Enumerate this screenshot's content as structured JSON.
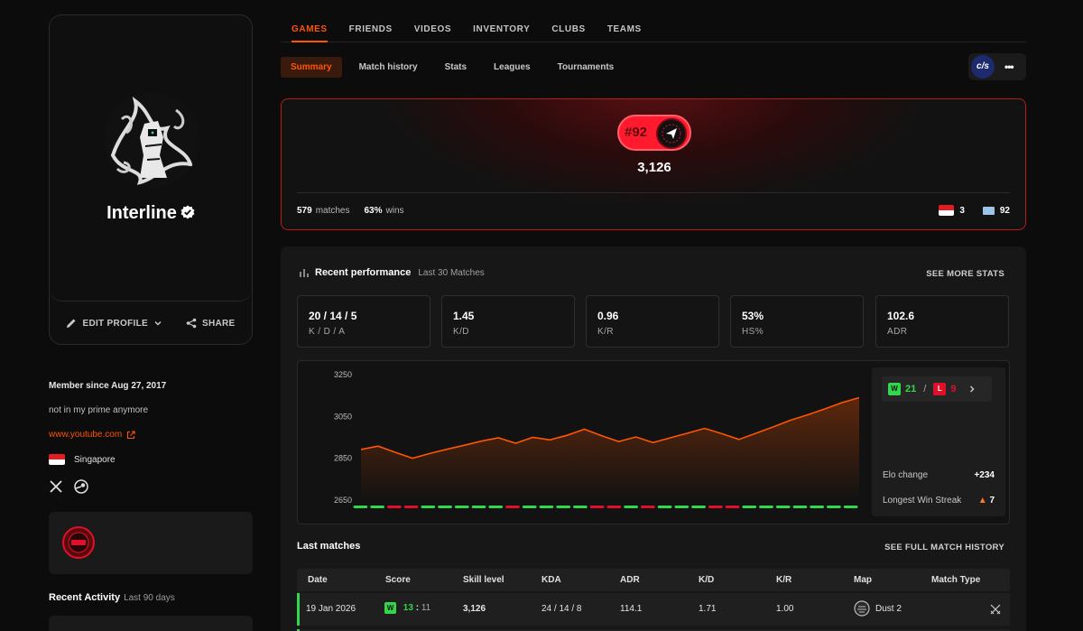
{
  "profile": {
    "nickname": "Interline",
    "edit_label": "EDIT PROFILE",
    "share_label": "SHARE",
    "member_since": "Member since Aug 27, 2017",
    "bio": "not in my prime anymore",
    "link": "www.youtube.com",
    "country": "Singapore",
    "recent_activity": "Recent Activity",
    "recent_activity_sub": "Last 90 days"
  },
  "nav": {
    "tabs": [
      "GAMES",
      "FRIENDS",
      "VIDEOS",
      "INVENTORY",
      "CLUBS",
      "TEAMS"
    ],
    "active_tab": "GAMES",
    "subtabs": [
      "Summary",
      "Match history",
      "Stats",
      "Leagues",
      "Tournaments"
    ],
    "active_subtab": "Summary",
    "game_logo": "c/s",
    "more": "•••"
  },
  "elo": {
    "rank": "#92",
    "value": "3,126",
    "matches": "579",
    "matches_label": "matches",
    "winrate": "63%",
    "wins_label": "wins",
    "country_rank": "3",
    "region_rank": "92"
  },
  "performance": {
    "title": "Recent performance",
    "subtitle": "Last 30 Matches",
    "see_more": "SEE MORE STATS",
    "stats": [
      {
        "value": "20 / 14 / 5",
        "label": "K / D / A"
      },
      {
        "value": "1.45",
        "label": "K/D"
      },
      {
        "value": "0.96",
        "label": "K/R"
      },
      {
        "value": "53%",
        "label": "HS%"
      },
      {
        "value": "102.6",
        "label": "ADR"
      }
    ],
    "wins": "21",
    "losses": "9",
    "wl_sep": "/",
    "w_letter": "W",
    "l_letter": "L",
    "elo_change_label": "Elo change",
    "elo_change": "+234",
    "streak_label": "Longest Win Streak",
    "streak": "7"
  },
  "chart_data": {
    "type": "line",
    "title": "",
    "xlabel": "",
    "ylabel": "",
    "ylim": [
      2650,
      3250
    ],
    "yticks": [
      "3250",
      "3050",
      "2850",
      "2650"
    ],
    "values": [
      2892,
      2908,
      2878,
      2850,
      2873,
      2893,
      2912,
      2932,
      2948,
      2922,
      2950,
      2938,
      2960,
      2989,
      2958,
      2930,
      2952,
      2925,
      2948,
      2970,
      2993,
      2968,
      2940,
      2970,
      3000,
      3032,
      3058,
      3086,
      3116,
      3140
    ],
    "results": [
      "W",
      "W",
      "L",
      "L",
      "W",
      "W",
      "W",
      "W",
      "W",
      "L",
      "W",
      "W",
      "W",
      "W",
      "L",
      "L",
      "W",
      "L",
      "W",
      "W",
      "W",
      "L",
      "L",
      "W",
      "W",
      "W",
      "W",
      "W",
      "W",
      "W"
    ],
    "colors": {
      "line": "#ff5500",
      "win": "#32d74b",
      "loss": "#e0102a"
    }
  },
  "matches": {
    "title": "Last matches",
    "link": "SEE FULL MATCH HISTORY",
    "columns": [
      "Date",
      "Score",
      "Skill level",
      "KDA",
      "ADR",
      "K/D",
      "K/R",
      "Map",
      "Match Type"
    ],
    "rows": [
      {
        "date": "19 Jan 2026",
        "result": "W",
        "score_a": "13",
        "score_sep": ":",
        "score_b": "11",
        "elo": "3,126",
        "kda": "24 / 14 / 8",
        "adr": "114.1",
        "kd": "1.71",
        "kr": "1.00",
        "map": "Dust 2"
      }
    ]
  }
}
